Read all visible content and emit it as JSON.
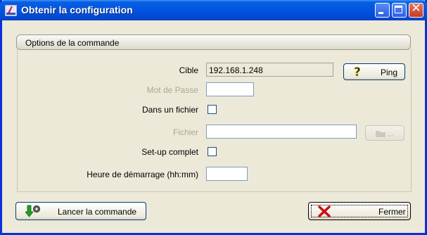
{
  "window": {
    "title": "Obtenir la configuration"
  },
  "group": {
    "title": "Options de la commande"
  },
  "form": {
    "cible_label": "Cible",
    "cible_value": "192.168.1.248",
    "ping_label": "Ping",
    "password_label": "Mot de Passe",
    "password_value": "",
    "dans_fichier_label": "Dans un fichier",
    "dans_fichier_checked": false,
    "fichier_label": "Fichier",
    "fichier_value": "",
    "setup_label": "Set-up complet",
    "setup_checked": false,
    "heure_label": "Heure de démarrage (hh:mm)",
    "heure_value": ""
  },
  "buttons": {
    "lancer_label": "Lancer la commande",
    "fermer_label": "Fermer"
  },
  "icons": {
    "app": "app-icon",
    "ping": "help-question-icon",
    "browse": "folder-browse-icon",
    "lancer": "run-command-icon",
    "fermer": "red-x-icon"
  }
}
